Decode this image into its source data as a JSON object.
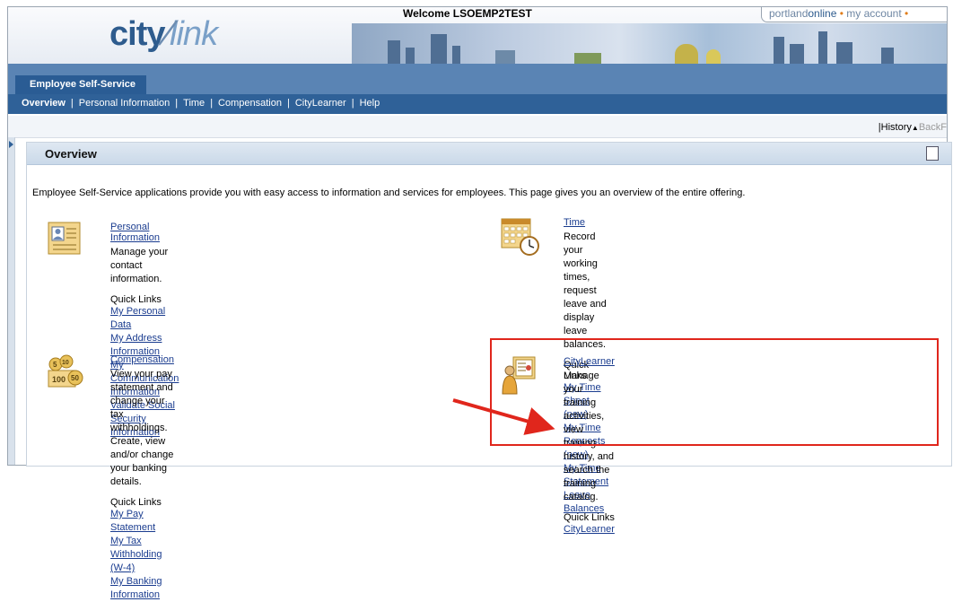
{
  "header": {
    "logo_text_city": "city",
    "logo_text_link": "link",
    "welcome": "Welcome LSOEMP2TEST",
    "portal_brand_a": "portland",
    "portal_brand_b": "online",
    "portal_sep": "•",
    "portal_account": "my account",
    "portal_sep2": "•"
  },
  "nav": {
    "top_tab": "Employee Self-Service",
    "items": [
      "Overview",
      "Personal Information",
      "Time",
      "Compensation",
      "CityLearner",
      "Help"
    ],
    "separator": "|"
  },
  "history": {
    "prefix": "|",
    "label": "History",
    "caret": "▲",
    "back": "BackF"
  },
  "panel": {
    "title": "Overview",
    "intro": "Employee Self-Service applications provide you with easy access to information and services for employees.  This page gives you an overview of the entire offering."
  },
  "cards": {
    "personal": {
      "title": "Personal Information",
      "desc": "Manage your contact information.",
      "quick_links_label": "Quick Links",
      "links": [
        "My Personal Data",
        "My Address Information",
        "My Communication Information",
        "Validate Social Security Information"
      ]
    },
    "time": {
      "title": "Time",
      "desc": "Record your working times, request leave and display leave balances.",
      "quick_links_label": "Quick Links",
      "links": [
        "My Time Sheet (new)",
        "My Time Requests (new)",
        "My Time Statement",
        "Leave Balances"
      ]
    },
    "compensation": {
      "title": "Compensation",
      "desc1": "View your pay statement and change your tax withholdings.  Create, view",
      "desc2": "and/or change your banking details.",
      "quick_links_label": "Quick Links",
      "links": [
        "My Pay Statement",
        "My Tax Withholding (W-4)",
        "My Banking Information"
      ]
    },
    "citylearner": {
      "title": "CityLearner",
      "desc1": "Manage your training activities, view training history, and search the training",
      "desc2": "catalog.",
      "quick_links_label": "Quick Links",
      "links": [
        "CityLearner"
      ]
    }
  },
  "coins": {
    "c1": "5",
    "c2": "10",
    "c3": "50",
    "c4": "100"
  },
  "colors": {
    "nav_bg": "#2f6198",
    "link": "#1a3c8f",
    "highlight": "#e0261c"
  }
}
